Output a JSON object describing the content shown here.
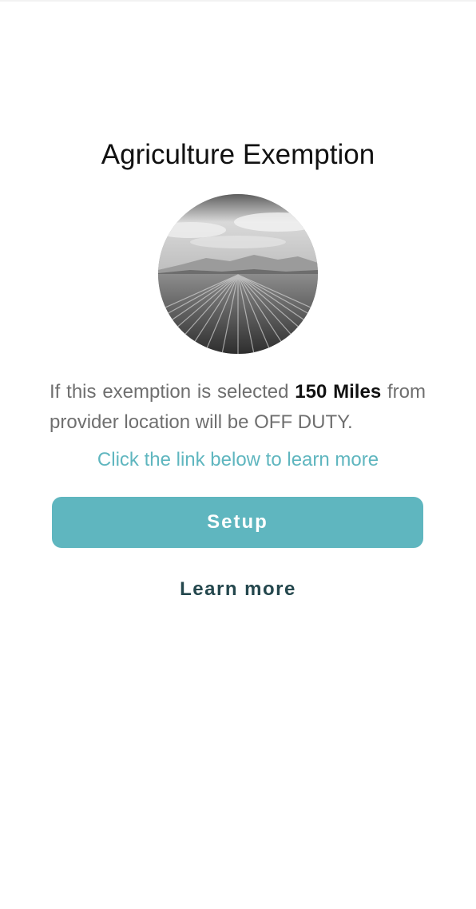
{
  "screen": {
    "title": "Agriculture Exemption",
    "image_alt": "farm field with crop rows",
    "description_prefix": "If this exemption is selected",
    "description_highlight": "150 Miles",
    "description_suffix": "from provider location will be OFF DUTY.",
    "hint": "Click the link below to learn more"
  },
  "actions": {
    "setup_label": "Setup",
    "learn_more_label": "Learn more"
  },
  "colors": {
    "accent": "#5fb6bf",
    "link_dark": "#24474d",
    "body_text": "#6f6f6f",
    "title_text": "#111111"
  }
}
